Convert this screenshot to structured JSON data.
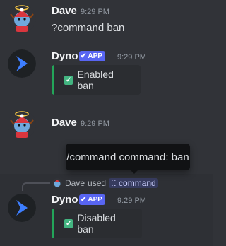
{
  "messages": [
    {
      "author": "Dave",
      "time": "9:29 PM",
      "text": "?command ban"
    },
    {
      "author": "Dyno",
      "badge": "APP",
      "time": "9:29 PM",
      "embed": "Enabled ban"
    },
    {
      "author": "Dave",
      "time": "9:29 PM"
    },
    {
      "author": "Dyno",
      "badge": "APP",
      "time": "9:29 PM",
      "embed": "Disabled ban"
    }
  ],
  "tooltip": "/command command: ban",
  "reply": {
    "user": "Dave",
    "verb": "used",
    "command": "command"
  },
  "colors": {
    "background": "#313338",
    "embed_bar": "#23a559",
    "app_badge": "#5865f2",
    "dyno_avatar": "#1e2124",
    "dyno_logo": "#3d7eff"
  },
  "icons": [
    "dave-avatar",
    "dyno-avatar",
    "check-icon",
    "verified-check-icon",
    "slash-command-icon"
  ]
}
